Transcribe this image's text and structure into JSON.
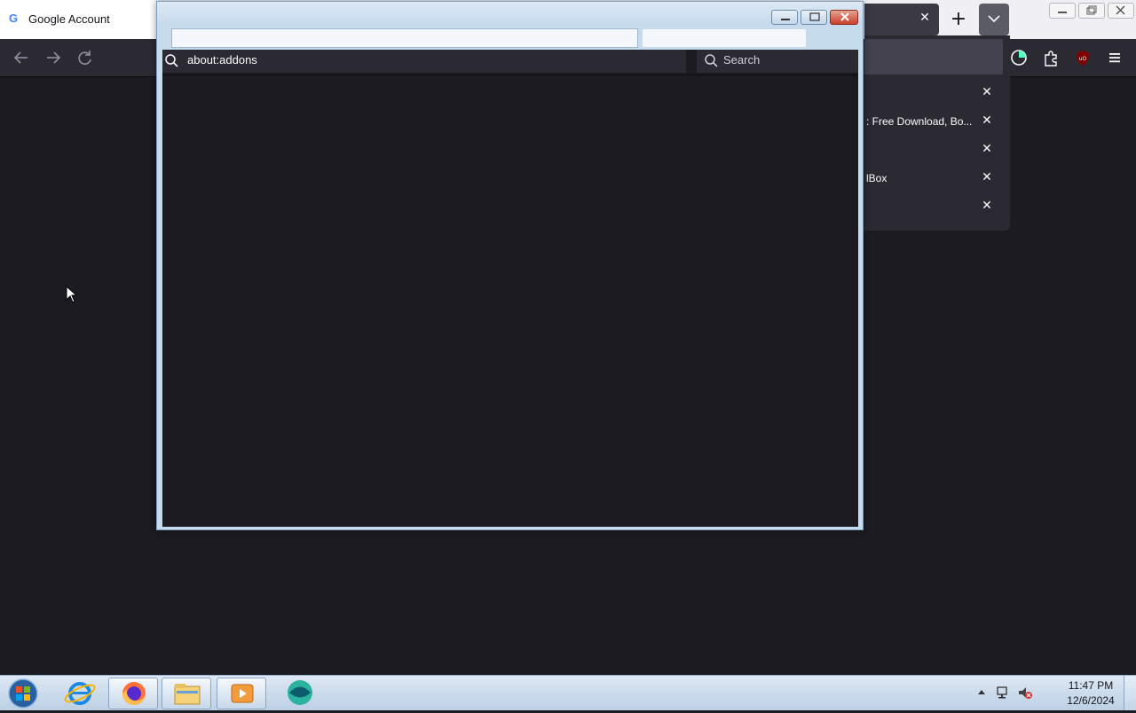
{
  "background_browser": {
    "tab_title": "Google Account",
    "tab_favicon": "G",
    "newtab_label": "+",
    "close_glyph": "✕",
    "tabs_panel_rows": [
      {
        "label": ""
      },
      {
        "label": ": Free Download, Bo..."
      },
      {
        "label": ""
      },
      {
        "label": "lBox"
      },
      {
        "label": ""
      }
    ]
  },
  "popup": {
    "url_text": "about:addons",
    "search_placeholder": "Search"
  },
  "taskbar": {
    "time": "11:47 PM",
    "date": "12/6/2024",
    "apps": [
      "internet-explorer-icon",
      "firefox-icon",
      "file-explorer-icon",
      "media-player-icon",
      "app-icon"
    ]
  }
}
